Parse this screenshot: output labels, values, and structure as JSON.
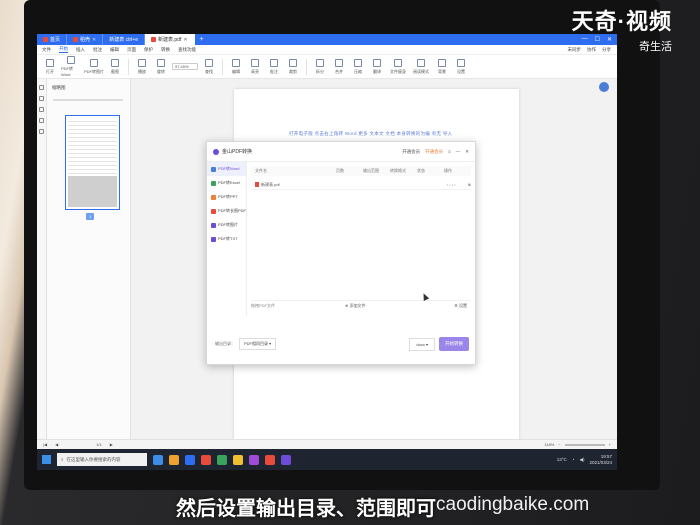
{
  "watermark": {
    "title": "天奇·视频",
    "subtitle": "奇生活"
  },
  "caption": "然后设置输出目录、范围即可",
  "site_overlay": "caodingbaike.com",
  "tabs": [
    {
      "label": "首页",
      "active": false
    },
    {
      "label": "稻壳",
      "active": false
    },
    {
      "label": "新建表 ctrl+e",
      "active": false
    },
    {
      "label": "新建表.pdf",
      "active": true
    }
  ],
  "menu": {
    "items": [
      "文件",
      "开始",
      "插入",
      "批注",
      "编辑",
      "页面",
      "保护",
      "转换",
      "查找功能"
    ],
    "active_index": 1,
    "right": [
      "未同步",
      "协作",
      "分享"
    ]
  },
  "ribbon": {
    "buttons": [
      "打开",
      "PDF转Word",
      "PDF转图片",
      "截图",
      "播放",
      "旋转",
      "查找",
      "编辑",
      "高亮",
      "批注",
      "裁剪",
      "拆分",
      "合并",
      "压缩",
      "翻译",
      "文件瘦身",
      "阅读模式",
      "背景",
      "设置"
    ],
    "zoom_value": "97.45%"
  },
  "thumbnails": {
    "title": "缩略图",
    "page_label": "1"
  },
  "document": {
    "text": "打开电子版  点击右上角转  Word  更多  文本文  文档  本身转换的为编  有无  导入"
  },
  "statusbar": {
    "page": "1/1",
    "zoom": "118%"
  },
  "dialog": {
    "title": "金山PDF转换",
    "tools": [
      "开通会员",
      "开通会员"
    ],
    "sidebar": [
      "PDF转Word",
      "PDF转Excel",
      "PDF转PPT",
      "PDF转长图PDF",
      "PDF转图片",
      "PDF转TXT"
    ],
    "sidebar_colors": [
      "#4a7fd8",
      "#3aa55a",
      "#e8833a",
      "#e84b3c",
      "#6d4cd8",
      "#6d4cd8"
    ],
    "table_headers": [
      "文件名",
      "页数",
      "输出范围",
      "转换格式",
      "状态",
      "操作"
    ],
    "file": {
      "name": "新建表.pdf",
      "dots": "• • • •"
    },
    "add_files": "添加文件",
    "drag_hint": "拖拽PDF文件",
    "settings": "设置",
    "output_label": "输出目录：",
    "output_value": "PDF相同目录",
    "format_value": "docx",
    "convert_button": "开始转换"
  },
  "taskbar": {
    "search_placeholder": "在这里输入你要搜索的内容",
    "app_colors": [
      "#3c8de6",
      "#f0a030",
      "#2f6df0",
      "#e84b3c",
      "#3aa55a",
      "#f0c030",
      "#a04ad8",
      "#e84b3c",
      "#6d4cd8"
    ],
    "weather": "13°C",
    "time": "19:57",
    "date": "2021/03/24"
  }
}
